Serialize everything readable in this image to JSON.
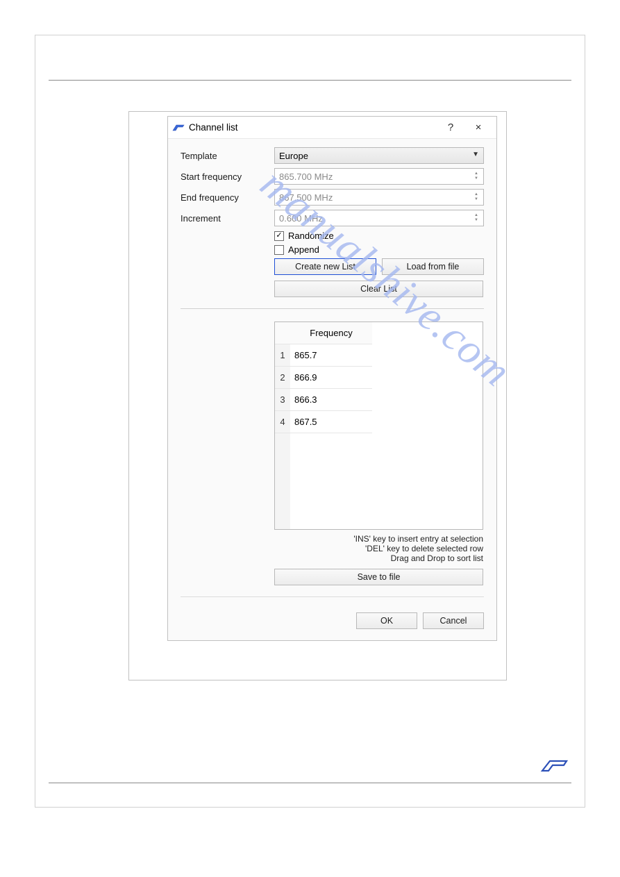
{
  "dialog": {
    "title": "Channel list",
    "help": "?",
    "close": "×",
    "fields": {
      "template_label": "Template",
      "template_value": "Europe",
      "start_label": "Start frequency",
      "start_value": "865.700 MHz",
      "end_label": "End frequency",
      "end_value": "867.500 MHz",
      "increment_label": "Increment",
      "increment_value": "0.600 MHz"
    },
    "randomize_label": "Randomize",
    "randomize_checked": "✓",
    "append_label": "Append",
    "append_checked": "",
    "buttons": {
      "create": "Create new List",
      "load": "Load from file",
      "clear": "Clear List",
      "save": "Save to file",
      "ok": "OK",
      "cancel": "Cancel"
    },
    "table": {
      "header": "Frequency",
      "rows": [
        {
          "idx": "1",
          "val": "865.7"
        },
        {
          "idx": "2",
          "val": "866.9"
        },
        {
          "idx": "3",
          "val": "866.3"
        },
        {
          "idx": "4",
          "val": "867.5"
        }
      ]
    },
    "hints": {
      "line1": "'INS' key to insert entry at selection",
      "line2": "'DEL' key to delete selected row",
      "line3": "Drag and Drop to sort list"
    }
  },
  "watermark_text": "manualshive.com"
}
